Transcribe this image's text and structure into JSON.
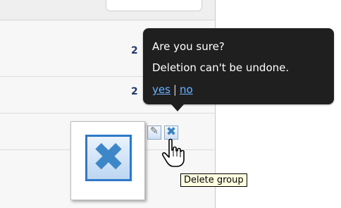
{
  "rows": [
    {
      "count": "2"
    },
    {
      "count": "2"
    }
  ],
  "tooltip": {
    "question": "Are you sure?",
    "message": "Deletion can't be undone.",
    "yes_label": "yes",
    "separator": "|",
    "no_label": "no"
  },
  "tooltip_hint": "Delete group",
  "icons": {
    "edit": "pencil-icon",
    "delete": "delete-x-icon",
    "cursor": "hand-pointer-cursor"
  },
  "colors": {
    "tooltip_bg": "#1f1f1f",
    "link": "#6db3ff",
    "icon_blue": "#3b82c2",
    "hint_bg": "#ffffe1"
  }
}
